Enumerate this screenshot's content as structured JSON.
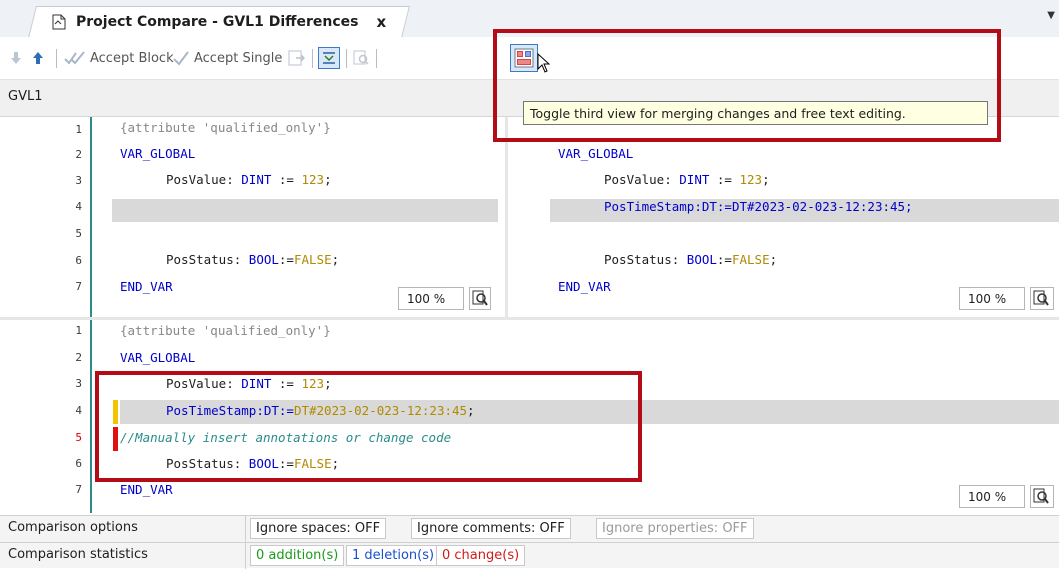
{
  "tab": {
    "title": "Project Compare - GVL1 Differences",
    "close": "x"
  },
  "toolbar": {
    "accept_block": "Accept Block",
    "accept_single": "Accept Single"
  },
  "path": "GVL1",
  "tooltip": "Toggle third view for merging changes and free text editing.",
  "left_pane": {
    "lines": [
      "1",
      "2",
      "3",
      "4",
      "5",
      "6",
      "7"
    ],
    "zoom": "100 %"
  },
  "right_pane": {
    "zoom": "100 %"
  },
  "merge_pane": {
    "lines": [
      "1",
      "2",
      "3",
      "4",
      "5",
      "6",
      "7"
    ],
    "zoom": "100 %"
  },
  "code": {
    "attribute": "{attribute 'qualified_only'}",
    "var_global": "VAR_GLOBAL",
    "posvalue_name": "PosValue: ",
    "dint": "DINT",
    "assign_123": " := ",
    "v123": "123",
    "semi": ";",
    "posstatus_name": "PosStatus: ",
    "bool": "BOOL",
    "assign": ":=",
    "false": "FALSE",
    "end_var": "END_VAR",
    "ts_name": "PosTimeStamp",
    "ts_type": ":DT",
    "ts_value": "DT#2023-02-023-12:23:45",
    "comment": "//Manually insert annotations or change code"
  },
  "status": {
    "options_label": "Comparison options",
    "ignore_spaces": "Ignore spaces: OFF",
    "ignore_comments": "Ignore comments: OFF",
    "ignore_properties": "Ignore properties: OFF",
    "stats_label": "Comparison statistics",
    "additions": "0 addition(s)",
    "deletions": "1 deletion(s)",
    "changes": "0 change(s)"
  },
  "colors": {
    "highlight_red": "#b40c17",
    "addition": "#1a9b1a",
    "deletion": "#1a4fd1",
    "change": "#d11a1a"
  }
}
